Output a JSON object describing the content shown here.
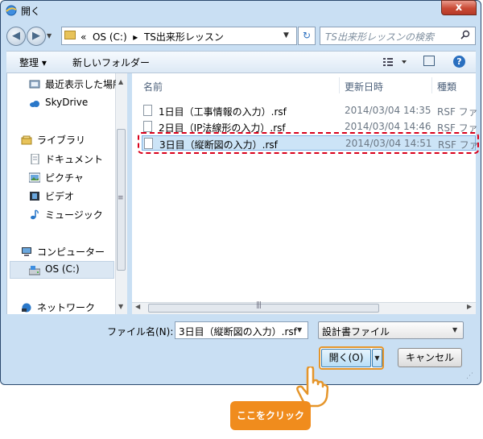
{
  "window": {
    "title": "開く",
    "close_label": "x"
  },
  "address": {
    "path_prefix": "«",
    "drive": "OS (C:)",
    "separator": "▸",
    "folder": "TS出来形レッスン",
    "search_placeholder": "TS出来形レッスンの検索"
  },
  "toolbar": {
    "organize_label": "整理 ▾",
    "new_folder_label": "新しいフォルダー",
    "help_label": "?"
  },
  "nav": {
    "recent": "最近表示した場所",
    "skydrive": "SkyDrive",
    "libraries": "ライブラリ",
    "documents": "ドキュメント",
    "pictures": "ピクチャ",
    "videos": "ビデオ",
    "music": "ミュージック",
    "computer": "コンピューター",
    "drive_c": "OS (C:)",
    "network": "ネットワーク"
  },
  "files": {
    "columns": {
      "name": "名前",
      "date": "更新日時",
      "type": "種類"
    },
    "rows": [
      {
        "name": "1日目（工事情報の入力）.rsf",
        "date": "2014/03/04 14:35",
        "type": "RSF ファ"
      },
      {
        "name": "2日目（IP法線形の入力）.rsf",
        "date": "2014/03/04 14:46",
        "type": "RSF ファ"
      },
      {
        "name": "3日目（縦断図の入力）.rsf",
        "date": "2014/03/04 14:51",
        "type": "RSF ファ"
      }
    ],
    "selected_index": 2
  },
  "bottom": {
    "filename_label": "ファイル名(N):",
    "filename_value": "3日目（縦断図の入力）.rsf",
    "filetype_value": "設計書ファイル",
    "open_label": "開く(O)",
    "cancel_label": "キャンセル"
  },
  "callout": {
    "text": "ここをクリック"
  },
  "colors": {
    "accent": "#f08c1d",
    "highlight": "#d9001b",
    "selection": "#cce4f7"
  }
}
